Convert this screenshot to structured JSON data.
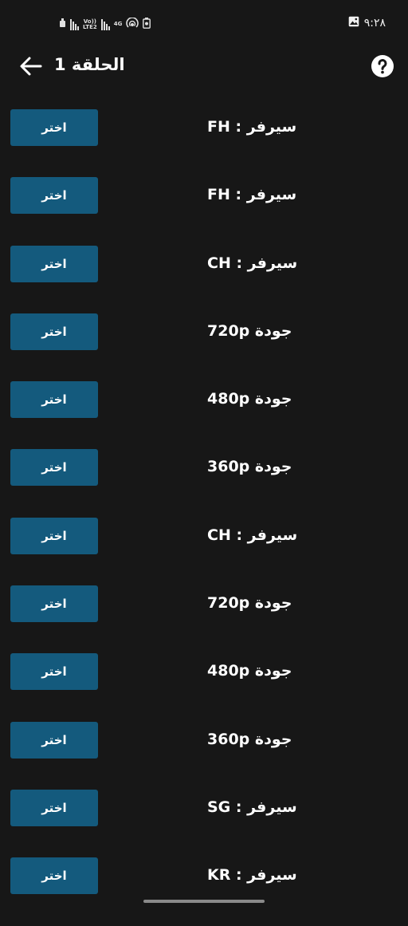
{
  "status_bar": {
    "time": "٩:٢٨",
    "network_type": "4G",
    "lte_label_top": "Vo))",
    "lte_label_bottom": "LTE2",
    "icons": [
      "notification-icon",
      "signal-icon",
      "signal-icon",
      "hotspot-icon",
      "battery-saver-icon",
      "gallery-icon"
    ]
  },
  "app_bar": {
    "title": "الحلقة 1",
    "back_icon": "arrow-left-icon",
    "help_icon": "help-circle-icon"
  },
  "servers": [
    {
      "label": "سيرفر : FH",
      "button": "اختر"
    },
    {
      "label": "سيرفر : FH",
      "button": "اختر"
    },
    {
      "label": "سيرفر : CH",
      "button": "اختر"
    },
    {
      "label": "جودة 720p",
      "button": "اختر"
    },
    {
      "label": "جودة 480p",
      "button": "اختر"
    },
    {
      "label": "جودة 360p",
      "button": "اختر"
    },
    {
      "label": "سيرفر : CH",
      "button": "اختر"
    },
    {
      "label": "جودة 720p",
      "button": "اختر"
    },
    {
      "label": "جودة 480p",
      "button": "اختر"
    },
    {
      "label": "جودة 360p",
      "button": "اختر"
    },
    {
      "label": "سيرفر : SG",
      "button": "اختر"
    },
    {
      "label": "سيرفر : KR",
      "button": "اختر"
    }
  ],
  "colors": {
    "background": "#171717",
    "button": "#145a7d",
    "text": "#ffffff"
  }
}
